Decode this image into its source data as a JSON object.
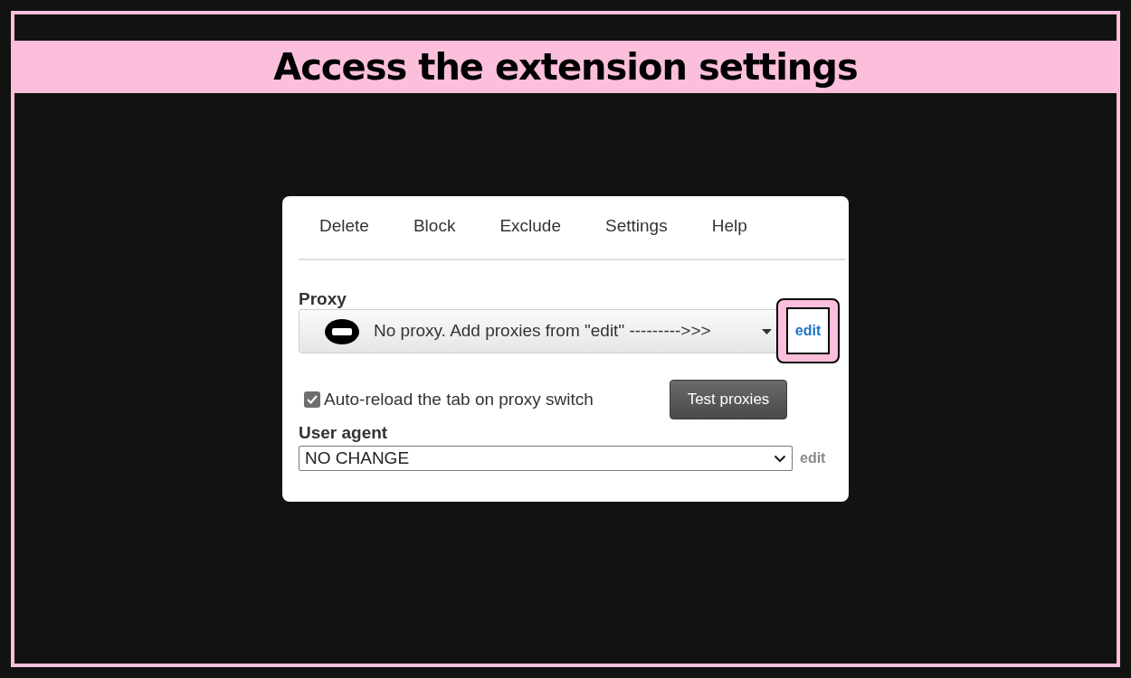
{
  "banner": {
    "title": "Access the extension settings"
  },
  "popup": {
    "menu": [
      {
        "label": "Delete"
      },
      {
        "label": "Block"
      },
      {
        "label": "Exclude"
      },
      {
        "label": "Settings"
      },
      {
        "label": "Help"
      }
    ],
    "proxy": {
      "label": "Proxy",
      "value": "No proxy. Add proxies from \"edit\" --------->>>",
      "edit_link": {
        "text": "edit",
        "highlighted": true
      }
    },
    "auto_reload": {
      "label": "Auto-reload the tab on proxy switch",
      "checked": true
    },
    "test_button": "Test proxies",
    "user_agent": {
      "label": "User agent",
      "value": "NO CHANGE",
      "edit_link": {
        "text": "edit",
        "highlighted": false
      }
    }
  }
}
